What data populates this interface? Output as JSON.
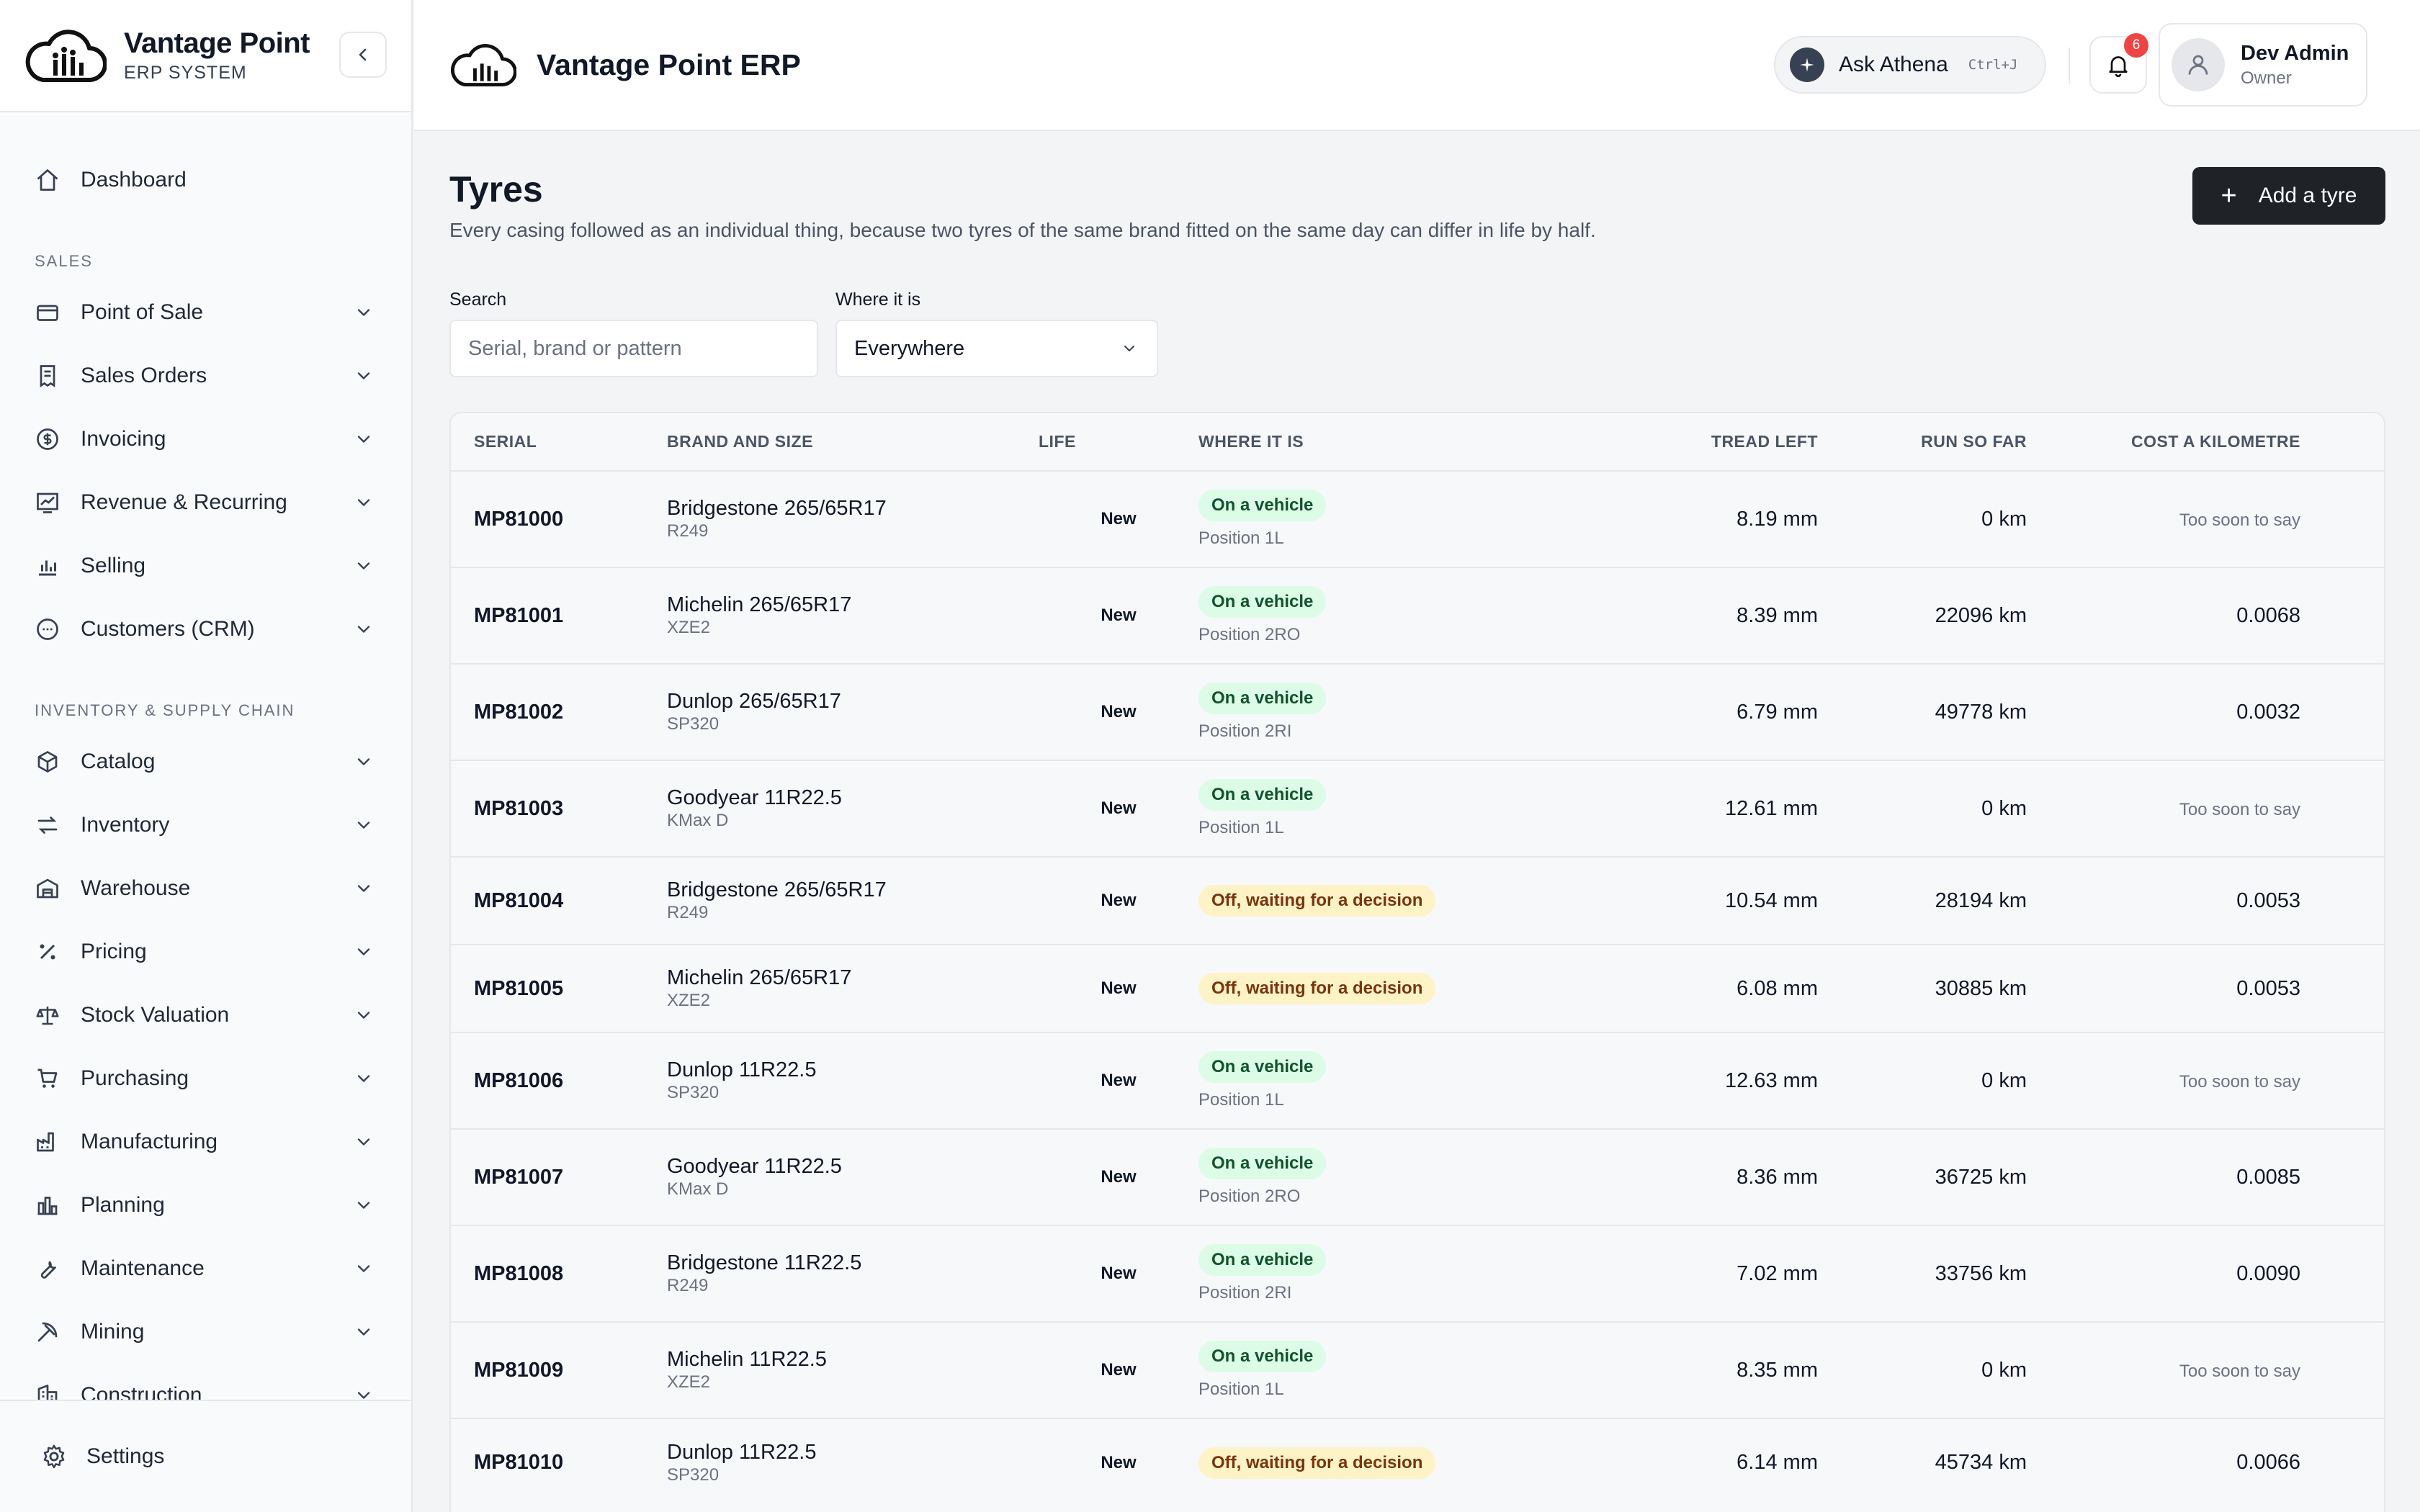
{
  "brand": {
    "name": "Vantage Point",
    "subtitle": "ERP SYSTEM"
  },
  "header": {
    "app_title": "Vantage Point ERP",
    "ask": {
      "label": "Ask Athena",
      "shortcut": "Ctrl+J"
    },
    "notifications": {
      "count": "6"
    },
    "user": {
      "name": "Dev Admin",
      "role": "Owner"
    }
  },
  "sidebar": {
    "dashboard": "Dashboard",
    "sections": [
      {
        "title": "SALES",
        "items": [
          {
            "label": "Point of Sale",
            "icon": "card-icon"
          },
          {
            "label": "Sales Orders",
            "icon": "receipt-icon"
          },
          {
            "label": "Invoicing",
            "icon": "dollar-icon"
          },
          {
            "label": "Revenue & Recurring",
            "icon": "trend-icon"
          },
          {
            "label": "Selling",
            "icon": "bar-chart-icon"
          },
          {
            "label": "Customers (CRM)",
            "icon": "chat-icon"
          }
        ]
      },
      {
        "title": "INVENTORY & SUPPLY CHAIN",
        "items": [
          {
            "label": "Catalog",
            "icon": "box-icon"
          },
          {
            "label": "Inventory",
            "icon": "transfer-icon"
          },
          {
            "label": "Warehouse",
            "icon": "warehouse-icon"
          },
          {
            "label": "Pricing",
            "icon": "percent-icon"
          },
          {
            "label": "Stock Valuation",
            "icon": "scale-icon"
          },
          {
            "label": "Purchasing",
            "icon": "cart-icon"
          },
          {
            "label": "Manufacturing",
            "icon": "factory-icon"
          },
          {
            "label": "Planning",
            "icon": "columns-icon"
          },
          {
            "label": "Maintenance",
            "icon": "wrench-icon"
          },
          {
            "label": "Mining",
            "icon": "pickaxe-icon"
          },
          {
            "label": "Construction",
            "icon": "building-icon"
          }
        ]
      }
    ],
    "footer": {
      "label": "Settings",
      "icon": "gear-icon"
    }
  },
  "page": {
    "title": "Tyres",
    "subtitle": "Every casing followed as an individual thing, because two tyres of the same brand fitted on the same day can differ in life by half.",
    "add_button": "Add a tyre",
    "search": {
      "label": "Search",
      "placeholder": "Serial, brand or pattern",
      "value": ""
    },
    "location_filter": {
      "label": "Where it is",
      "value": "Everywhere"
    }
  },
  "table": {
    "columns": [
      "SERIAL",
      "BRAND AND SIZE",
      "LIFE",
      "WHERE IT IS",
      "TREAD LEFT",
      "RUN SO FAR",
      "COST A KILOMETRE"
    ],
    "rows": [
      {
        "serial": "MP81000",
        "brand": "Bridgestone 265/65R17",
        "pattern": "R249",
        "life": "New",
        "status": "On a vehicle",
        "status_kind": "green",
        "position": "Position 1L",
        "tread": "8.19 mm",
        "run": "0 km",
        "cost": "Too soon to say"
      },
      {
        "serial": "MP81001",
        "brand": "Michelin 265/65R17",
        "pattern": "XZE2",
        "life": "New",
        "status": "On a vehicle",
        "status_kind": "green",
        "position": "Position 2RO",
        "tread": "8.39 mm",
        "run": "22096 km",
        "cost": "0.0068"
      },
      {
        "serial": "MP81002",
        "brand": "Dunlop 265/65R17",
        "pattern": "SP320",
        "life": "New",
        "status": "On a vehicle",
        "status_kind": "green",
        "position": "Position 2RI",
        "tread": "6.79 mm",
        "run": "49778 km",
        "cost": "0.0032"
      },
      {
        "serial": "MP81003",
        "brand": "Goodyear 11R22.5",
        "pattern": "KMax D",
        "life": "New",
        "status": "On a vehicle",
        "status_kind": "green",
        "position": "Position 1L",
        "tread": "12.61 mm",
        "run": "0 km",
        "cost": "Too soon to say"
      },
      {
        "serial": "MP81004",
        "brand": "Bridgestone 265/65R17",
        "pattern": "R249",
        "life": "New",
        "status": "Off, waiting for a decision",
        "status_kind": "amber",
        "position": "",
        "tread": "10.54 mm",
        "run": "28194 km",
        "cost": "0.0053"
      },
      {
        "serial": "MP81005",
        "brand": "Michelin 265/65R17",
        "pattern": "XZE2",
        "life": "New",
        "status": "Off, waiting for a decision",
        "status_kind": "amber",
        "position": "",
        "tread": "6.08 mm",
        "run": "30885 km",
        "cost": "0.0053"
      },
      {
        "serial": "MP81006",
        "brand": "Dunlop 11R22.5",
        "pattern": "SP320",
        "life": "New",
        "status": "On a vehicle",
        "status_kind": "green",
        "position": "Position 1L",
        "tread": "12.63 mm",
        "run": "0 km",
        "cost": "Too soon to say"
      },
      {
        "serial": "MP81007",
        "brand": "Goodyear 11R22.5",
        "pattern": "KMax D",
        "life": "New",
        "status": "On a vehicle",
        "status_kind": "green",
        "position": "Position 2RO",
        "tread": "8.36 mm",
        "run": "36725 km",
        "cost": "0.0085"
      },
      {
        "serial": "MP81008",
        "brand": "Bridgestone 11R22.5",
        "pattern": "R249",
        "life": "New",
        "status": "On a vehicle",
        "status_kind": "green",
        "position": "Position 2RI",
        "tread": "7.02 mm",
        "run": "33756 km",
        "cost": "0.0090"
      },
      {
        "serial": "MP81009",
        "brand": "Michelin 11R22.5",
        "pattern": "XZE2",
        "life": "New",
        "status": "On a vehicle",
        "status_kind": "green",
        "position": "Position 1L",
        "tread": "8.35 mm",
        "run": "0 km",
        "cost": "Too soon to say"
      },
      {
        "serial": "MP81010",
        "brand": "Dunlop 11R22.5",
        "pattern": "SP320",
        "life": "New",
        "status": "Off, waiting for a decision",
        "status_kind": "amber",
        "position": "",
        "tread": "6.14 mm",
        "run": "45734 km",
        "cost": "0.0066"
      }
    ]
  },
  "colors": {
    "primary_button": "#1f2328",
    "on_vehicle": "#dcfce7",
    "off_waiting": "#fef3c7",
    "badge": "#ef4444"
  }
}
